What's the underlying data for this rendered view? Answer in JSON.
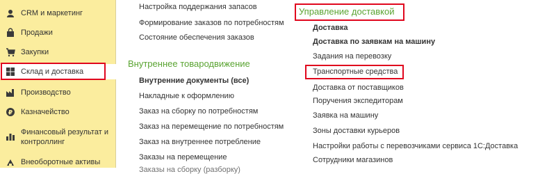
{
  "sidebar": {
    "items": [
      {
        "label": "CRM и маркетинг",
        "icon": "crm-icon"
      },
      {
        "label": "Продажи",
        "icon": "sales-bag-icon"
      },
      {
        "label": "Закупки",
        "icon": "shopping-cart-icon"
      },
      {
        "label": "Склад и доставка",
        "icon": "warehouse-grid-icon",
        "active": true
      },
      {
        "label": "Производство",
        "icon": "factory-icon"
      },
      {
        "label": "Казначейство",
        "icon": "treasury-coin-icon"
      },
      {
        "label": "Финансовый результат и контроллинг",
        "icon": "bar-chart-icon"
      },
      {
        "label": "Внеоборотные активы",
        "icon": "assets-icon"
      }
    ]
  },
  "col1": {
    "top_links": [
      "Настройка поддержания запасов",
      "Формирование заказов по потребностям",
      "Состояние обеспечения заказов"
    ],
    "section_title": "Внутреннее товародвижение",
    "section_links": [
      "Внутренние документы (все)",
      "Накладные к оформлению",
      "Заказ на сборку по потребностям",
      "Заказ на перемещение по потребностям",
      "Заказ на внутреннее потребление",
      "Заказы на перемещение",
      "Заказы на сборку (разборку)"
    ]
  },
  "col2": {
    "section_title": "Управление доставкой",
    "links": [
      "Доставка",
      "Доставка по заявкам на машину",
      "Задания на перевозку",
      "Транспортные средства",
      "Доставка от поставщиков",
      "Поручения экспедиторам",
      "Заявка на машину",
      "Зоны доставки курьеров",
      "Настройки работы с перевозчиками сервиса 1С:Доставка",
      "Сотрудники магазинов"
    ]
  },
  "colors": {
    "sidebar_bg": "#fbed9e",
    "section_title": "#5aa432",
    "highlight": "#e0061d"
  }
}
